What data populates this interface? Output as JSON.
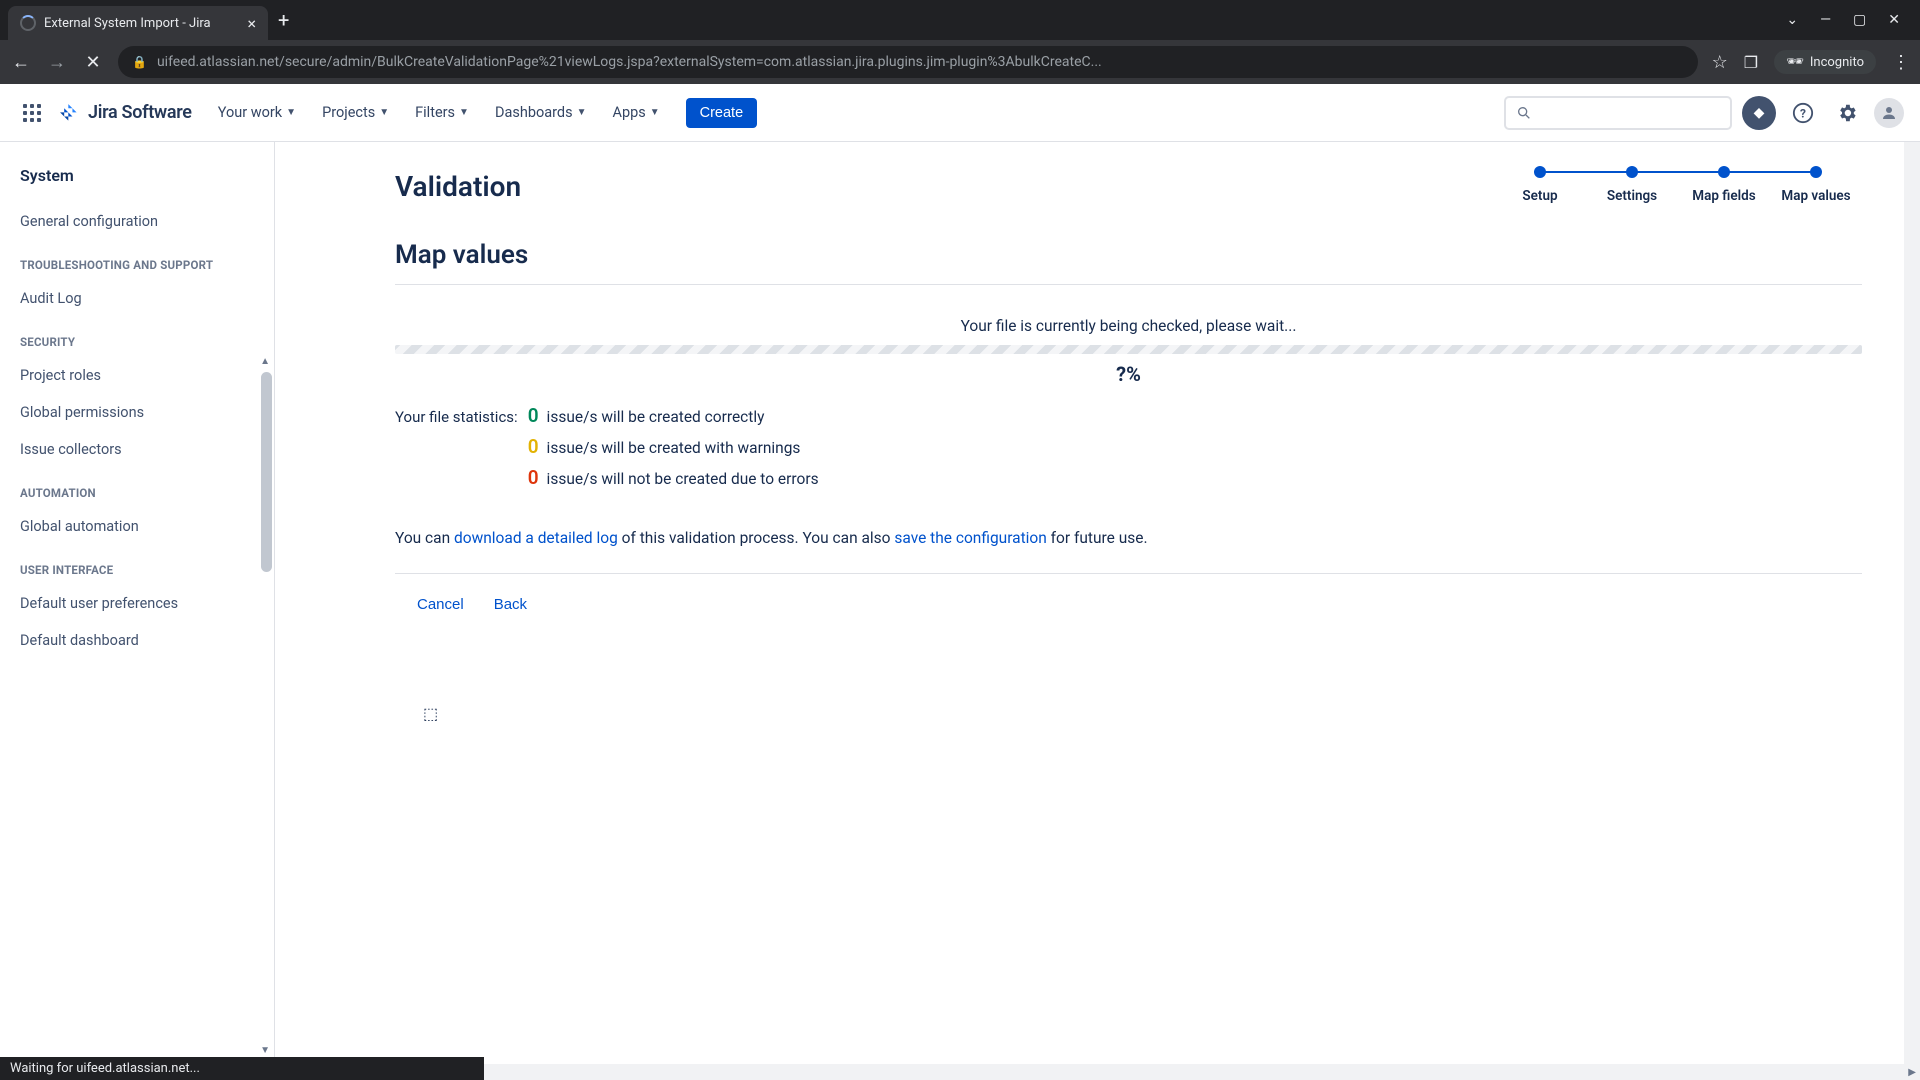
{
  "browser": {
    "tab_title": "External System Import - Jira",
    "url": "uifeed.atlassian.net/secure/admin/BulkCreateValidationPage%21viewLogs.jspa?externalSystem=com.atlassian.jira.plugins.jim-plugin%3AbulkCreateC...",
    "incognito_label": "Incognito",
    "status_text": "Waiting for uifeed.atlassian.net..."
  },
  "header": {
    "logo_text": "Jira Software",
    "nav": {
      "your_work": "Your work",
      "projects": "Projects",
      "filters": "Filters",
      "dashboards": "Dashboards",
      "apps": "Apps"
    },
    "create_label": "Create"
  },
  "sidebar": {
    "title": "System",
    "general_config": "General configuration",
    "section_troubleshooting": "TROUBLESHOOTING AND SUPPORT",
    "audit_log": "Audit Log",
    "section_security": "SECURITY",
    "project_roles": "Project roles",
    "global_permissions": "Global permissions",
    "issue_collectors": "Issue collectors",
    "section_automation": "AUTOMATION",
    "global_automation": "Global automation",
    "section_ui": "USER INTERFACE",
    "default_user_prefs": "Default user preferences",
    "default_dashboard": "Default dashboard"
  },
  "stepper": {
    "s1": "Setup",
    "s2": "Settings",
    "s3": "Map fields",
    "s4": "Map values"
  },
  "main": {
    "page_title": "Validation",
    "section_title": "Map values",
    "checking_text": "Your file is currently being checked, please wait...",
    "progress_pct": "?%",
    "stats_label": "Your file statistics:",
    "stat_ok_count": "0",
    "stat_ok_text": "issue/s will be created correctly",
    "stat_warn_count": "0",
    "stat_warn_text": "issue/s will be created with warnings",
    "stat_err_count": "0",
    "stat_err_text": "issue/s will not be created due to errors",
    "log_pre": "You can ",
    "log_link1": "download a detailed log",
    "log_mid": " of this validation process. You can also ",
    "log_link2": "save the configuration",
    "log_post": " for future use.",
    "cancel_label": "Cancel",
    "back_label": "Back"
  }
}
